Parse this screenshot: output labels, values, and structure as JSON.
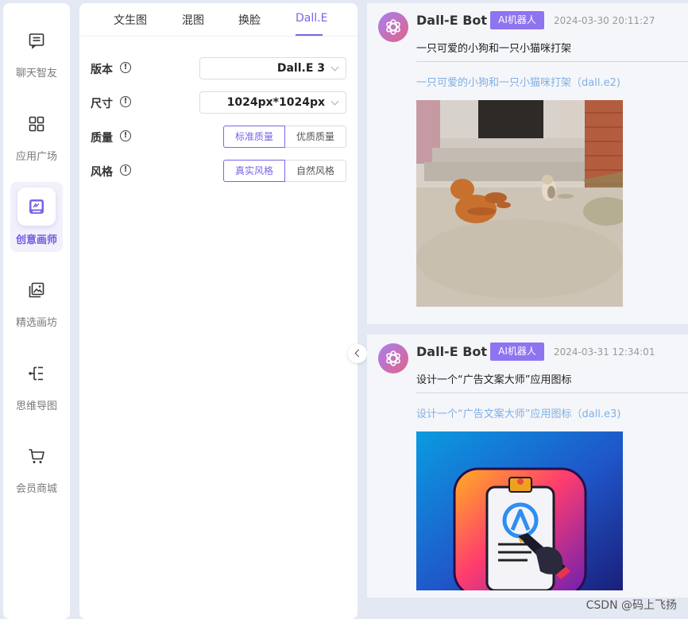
{
  "nav": {
    "items": [
      {
        "label": "聊天智友",
        "icon": "chat-icon",
        "active": false
      },
      {
        "label": "应用广场",
        "icon": "grid-icon",
        "active": false
      },
      {
        "label": "创意画师",
        "icon": "palette-icon",
        "active": true
      },
      {
        "label": "精选画坊",
        "icon": "gallery-icon",
        "active": false
      },
      {
        "label": "思维导图",
        "icon": "mindmap-icon",
        "active": false
      },
      {
        "label": "会员商城",
        "icon": "cart-icon",
        "active": false
      }
    ]
  },
  "panel": {
    "tabs": [
      {
        "label": "文生图"
      },
      {
        "label": "混图"
      },
      {
        "label": "换脸"
      },
      {
        "label": "Dall.E",
        "active": true
      }
    ],
    "version": {
      "label": "版本",
      "value": "Dall.E 3"
    },
    "size": {
      "label": "尺寸",
      "value": "1024px*1024px"
    },
    "quality": {
      "label": "质量",
      "options": [
        "标准质量",
        "优质质量"
      ],
      "selected": "标准质量"
    },
    "style": {
      "label": "风格",
      "options": [
        "真实风格",
        "自然风格"
      ],
      "selected": "真实风格"
    }
  },
  "messages": [
    {
      "bot_name": "Dall-E Bot",
      "badge": "AI机器人",
      "time": "2024-03-30 20:11:27",
      "prompt": "一只可爱的小狗和一只小猫咪打架",
      "link": "一只可爱的小狗和一只小猫咪打架（dall.e2)"
    },
    {
      "bot_name": "Dall-E Bot",
      "badge": "AI机器人",
      "time": "2024-03-31 12:34:01",
      "prompt": "设计一个“广告文案大师”应用图标",
      "link": "设计一个“广告文案大师”应用图标（dall.e3)"
    }
  ],
  "watermark": "CSDN @码上飞扬",
  "colors": {
    "accent": "#7b64e8",
    "badge": "#8e74f0",
    "link": "#7fb0e4"
  }
}
